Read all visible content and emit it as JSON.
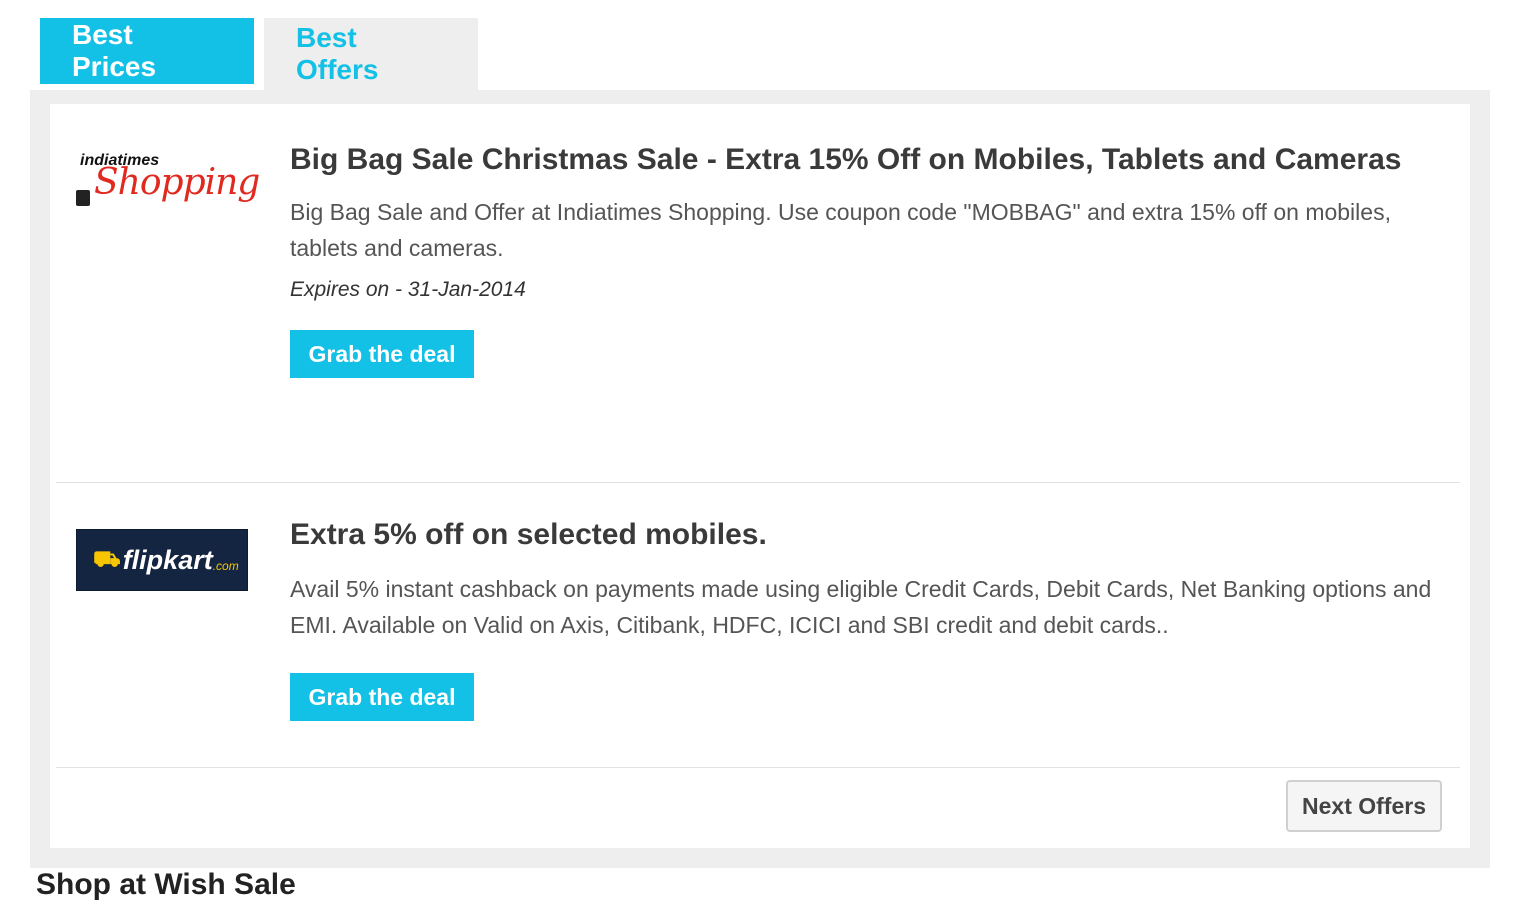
{
  "tabs": [
    {
      "label": "Best Prices",
      "active": true
    },
    {
      "label": "Best Offers",
      "active": false
    }
  ],
  "offers": [
    {
      "store": "indiatimes Shopping",
      "logo": {
        "top_text": "indiatimes",
        "script_text": "Shopping"
      },
      "title": "Big Bag Sale Christmas Sale - Extra 15% Off on Mobiles, Tablets and Cameras",
      "description": "Big Bag Sale and Offer at Indiatimes Shopping. Use coupon code \"MOBBAG\" and extra 15% off on mobiles, tablets and cameras.",
      "expiry": "Expires on - 31-Jan-2014",
      "button": "Grab the deal"
    },
    {
      "store": "flipkart.com",
      "logo": {
        "brand_text": "flipkart",
        "suffix": ".com"
      },
      "title": "Extra 5% off on selected mobiles.",
      "description": "Avail 5% instant cashback on payments made using eligible Credit Cards, Debit Cards, Net Banking options and EMI. Available on Valid on Axis, Citibank, HDFC, ICICI and SBI credit and debit cards..",
      "button": "Grab the deal"
    }
  ],
  "pagination": {
    "next_label": "Next Offers"
  },
  "below_fold_heading": "Shop at Wish Sale",
  "colors": {
    "accent": "#13c0e6",
    "panel_bg": "#eeeeee",
    "text": "#333333"
  }
}
